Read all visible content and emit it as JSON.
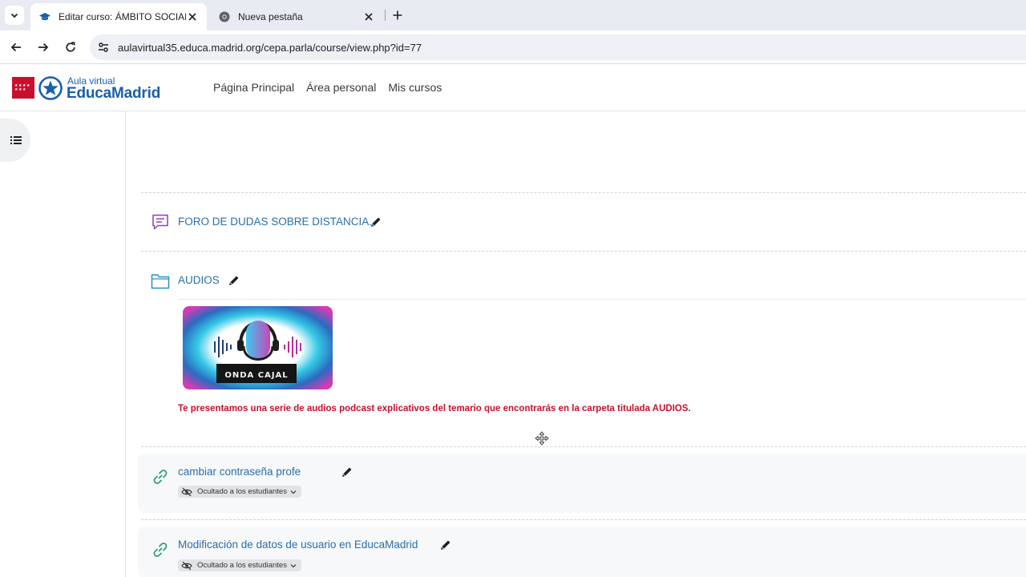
{
  "browser": {
    "tabs": [
      {
        "title": "Editar curso: ÁMBITO SOCIAL N",
        "active": true
      },
      {
        "title": "Nueva pestaña",
        "active": false
      }
    ],
    "url": "aulavirtual35.educa.madrid.org/cepa.parla/course/view.php?id=77"
  },
  "site": {
    "brand_small": "Aula virtual",
    "brand_big": "EducaMadrid",
    "nav": [
      "Página Principal",
      "Área personal",
      "Mis cursos"
    ],
    "accent_color": "#c8102e",
    "link_color": "#2a6ea8"
  },
  "activities": {
    "forum": {
      "label": "FORO DE DUDAS SOBRE DISTANCIA.",
      "icon": "forum-icon"
    },
    "audios": {
      "label": "AUDIOS",
      "icon": "folder-icon"
    },
    "audios_image_text": "ONDA CAJAL",
    "audios_description": "Te presentamos una serie de audios podcast explicativos del temario que encontrarás en la carpeta titulada AUDIOS.",
    "link1": {
      "label": "cambiar contraseña profe",
      "badge": "Ocultado a los estudiantes",
      "icon": "link-icon"
    },
    "link2": {
      "label": "Modificación de datos de usuario en EducaMadrid",
      "badge": "Ocultado a los estudiantes",
      "icon": "link-icon"
    }
  }
}
